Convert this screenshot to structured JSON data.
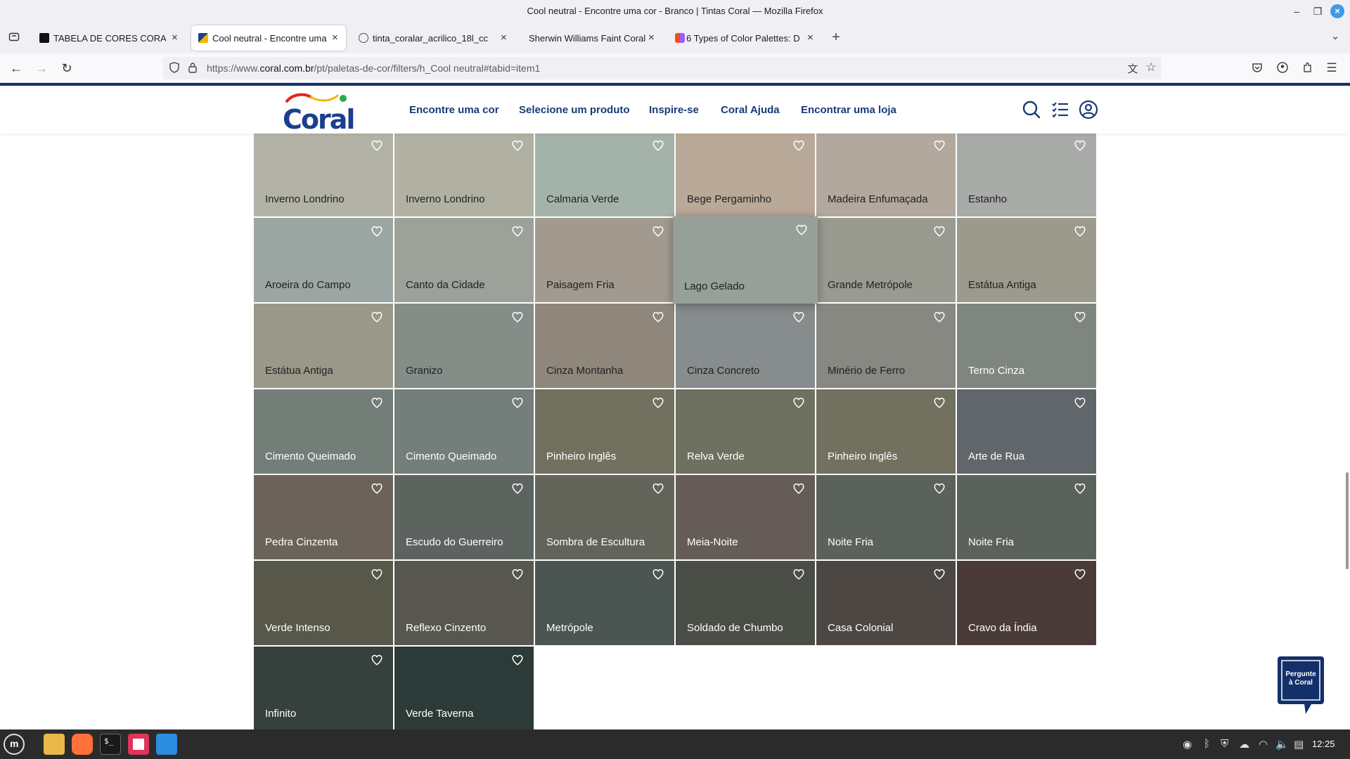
{
  "window": {
    "title": "Cool neutral - Encontre uma cor - Branco | Tintas Coral — Mozilla Firefox"
  },
  "tabs": [
    {
      "label": "TABELA DE CORES CORAL –",
      "icon": "site-favicon-dark",
      "active": false
    },
    {
      "label": "Cool neutral - Encontre uma",
      "icon": "coral-favicon",
      "active": true
    },
    {
      "label": "tinta_coralar_acrilico_18l_cc",
      "icon": "globe-icon",
      "active": false
    },
    {
      "label": "Sherwin Williams Faint Coral",
      "icon": "none",
      "active": false
    },
    {
      "label": "6 Types of Color Palettes: D",
      "icon": "figma-icon",
      "active": false
    }
  ],
  "url": {
    "prefix": "https://www.",
    "domain": "coral.com.br",
    "path": "/pt/paletas-de-cor/filters/h_Cool neutral#tabid=item1"
  },
  "site": {
    "logo_text": "Coral",
    "nav": [
      "Encontre uma cor",
      "Selecione um produto",
      "Inspire-se",
      "Coral Ajuda",
      "Encontrar uma loja"
    ],
    "chat_widget": "Pergunte à Coral"
  },
  "swatches": [
    {
      "name": "Inverno Londrino",
      "color": "#b2b2a6",
      "dark": false
    },
    {
      "name": "Inverno Londrino",
      "color": "#b1b1a3",
      "dark": false
    },
    {
      "name": "Calmaria Verde",
      "color": "#a3b3aa",
      "dark": false
    },
    {
      "name": "Bege Pergaminho",
      "color": "#b9a998",
      "dark": false
    },
    {
      "name": "Madeira Enfumaçada",
      "color": "#b2a89e",
      "dark": false
    },
    {
      "name": "Estanho",
      "color": "#a8aba8",
      "dark": false
    },
    {
      "name": "Aroeira do Campo",
      "color": "#9ba6a2",
      "dark": false
    },
    {
      "name": "Canto da Cidade",
      "color": "#9ca199",
      "dark": false
    },
    {
      "name": "Paisagem Fria",
      "color": "#a29a8f",
      "dark": false
    },
    {
      "name": "Lago Gelado",
      "color": "#96a099",
      "dark": false,
      "hover": true
    },
    {
      "name": "Grande Metrópole",
      "color": "#999b90",
      "dark": false
    },
    {
      "name": "Estátua Antiga",
      "color": "#9c9a8c",
      "dark": false
    },
    {
      "name": "Estátua Antiga",
      "color": "#9a9889",
      "dark": false
    },
    {
      "name": "Granizo",
      "color": "#848d88",
      "dark": false
    },
    {
      "name": "Cinza Montanha",
      "color": "#8f877b",
      "dark": false
    },
    {
      "name": "Cinza Concreto",
      "color": "#878c8c",
      "dark": false
    },
    {
      "name": "Minério de Ferro",
      "color": "#868881",
      "dark": false
    },
    {
      "name": "Terno Cinza",
      "color": "#7f8680",
      "dark": true
    },
    {
      "name": "Cimento Queimado",
      "color": "#747e79",
      "dark": true
    },
    {
      "name": "Cimento Queimado",
      "color": "#747e7a",
      "dark": true
    },
    {
      "name": "Pinheiro Inglês",
      "color": "#72705f",
      "dark": true
    },
    {
      "name": "Relva Verde",
      "color": "#6e7160",
      "dark": true
    },
    {
      "name": "Pinheiro Inglês",
      "color": "#727160",
      "dark": true
    },
    {
      "name": "Arte de Rua",
      "color": "#60666a",
      "dark": true
    },
    {
      "name": "Pedra Cinzenta",
      "color": "#6b6359",
      "dark": true
    },
    {
      "name": "Escudo do Guerreiro",
      "color": "#5d6460",
      "dark": true
    },
    {
      "name": "Sombra de Escultura",
      "color": "#626359",
      "dark": true
    },
    {
      "name": "Meia-Noite",
      "color": "#655c58",
      "dark": true
    },
    {
      "name": "Noite Fria",
      "color": "#5b625b",
      "dark": true
    },
    {
      "name": "Noite Fria",
      "color": "#5b625b",
      "dark": true
    },
    {
      "name": "Verde Intenso",
      "color": "#57574a",
      "dark": true
    },
    {
      "name": "Reflexo Cinzento",
      "color": "#575750",
      "dark": true
    },
    {
      "name": "Metrópole",
      "color": "#4b5652",
      "dark": true
    },
    {
      "name": "Soldado de Chumbo",
      "color": "#4a4d46",
      "dark": true
    },
    {
      "name": "Casa Colonial",
      "color": "#4d4743",
      "dark": true
    },
    {
      "name": "Cravo da Índia",
      "color": "#4a3b38",
      "dark": true
    },
    {
      "name": "Infinito",
      "color": "#36403d",
      "dark": true
    },
    {
      "name": "Verde Taverna",
      "color": "#2c3b38",
      "dark": true
    }
  ],
  "taskbar": {
    "clock": "12:25"
  }
}
